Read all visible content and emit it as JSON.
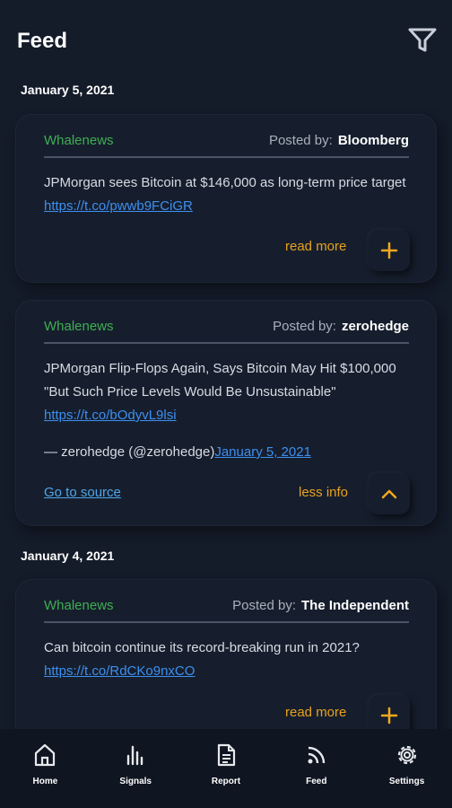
{
  "header": {
    "title": "Feed",
    "filter_icon": "filter-icon"
  },
  "groups": [
    {
      "date": "January 5, 2021"
    },
    {
      "date": "January 4, 2021"
    }
  ],
  "cards": [
    {
      "source": "Whalenews",
      "posted_label": "Posted by:",
      "author": "Bloomberg",
      "text": "JPMorgan sees Bitcoin at $146,000 as long-term price target ",
      "link": "https://t.co/pwwb9FCiGR",
      "action": "read more",
      "action_icon": "plus-icon"
    },
    {
      "source": "Whalenews",
      "posted_label": "Posted by:",
      "author": "zerohedge",
      "text": "JPMorgan Flip-Flops Again, Says Bitcoin May Hit $100,000 \"But Such Price Levels Would Be Unsustainable\" ",
      "link": "https://t.co/bOdyvL9lsi",
      "quote": "— zerohedge (@zerohedge)",
      "quote_date": "January 5, 2021",
      "go_source": "Go to source",
      "action": "less info",
      "action_icon": "chevron-up-icon"
    },
    {
      "source": "Whalenews",
      "posted_label": "Posted by:",
      "author": "The Independent",
      "text": "Can bitcoin continue its record-breaking run in 2021? ",
      "link": "https://t.co/RdCKo9nxCO",
      "action": "read more",
      "action_icon": "plus-icon"
    }
  ],
  "nav": [
    {
      "label": "Home",
      "icon": "home-icon"
    },
    {
      "label": "Signals",
      "icon": "signals-icon"
    },
    {
      "label": "Report",
      "icon": "report-icon"
    },
    {
      "label": "Feed",
      "icon": "feed-icon"
    },
    {
      "label": "Settings",
      "icon": "settings-icon"
    }
  ],
  "colors": {
    "background": "#141b29",
    "source_green": "#3fae53",
    "accent_orange": "#e8a21d",
    "link_blue": "#3d8ff0"
  }
}
